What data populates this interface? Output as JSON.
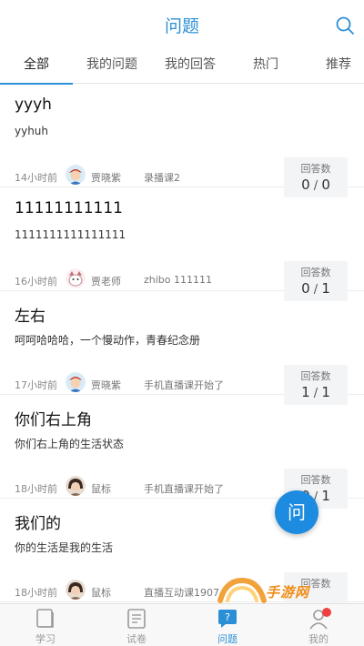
{
  "header": {
    "title": "问题"
  },
  "tabs": [
    {
      "label": "全部",
      "active": true
    },
    {
      "label": "我的问题",
      "active": false
    },
    {
      "label": "我的回答",
      "active": false
    },
    {
      "label": "热门",
      "active": false
    },
    {
      "label": "推荐",
      "active": false
    }
  ],
  "questions": [
    {
      "title": "yyyh",
      "desc": "yyhuh",
      "time": "14小时前",
      "author": "贾晓紫",
      "course": "录播课2",
      "answers_label": "回答数",
      "answered": "0",
      "total": "0",
      "avatar": "boy-avatar"
    },
    {
      "title": "11111111111",
      "desc": "1111111111111111",
      "time": "16小时前",
      "author": "贾老师",
      "course": "zhibo 111111",
      "answers_label": "回答数",
      "answered": "0",
      "total": "1",
      "avatar": "cartoon-avatar"
    },
    {
      "title": "左右",
      "desc": "呵呵哈哈哈，一个慢动作，青春纪念册",
      "time": "17小时前",
      "author": "贾晓紫",
      "course": "手机直播课开始了",
      "answers_label": "回答数",
      "answered": "1",
      "total": "1",
      "avatar": "boy-avatar"
    },
    {
      "title": "你们右上角",
      "desc": "你们右上角的生活状态",
      "time": "18小时前",
      "author": "鼠标",
      "course": "手机直播课开始了",
      "answers_label": "回答数",
      "answered": "0",
      "total": "1",
      "avatar": "girl-avatar"
    },
    {
      "title": "我们的",
      "desc": "你的生活是我的生活",
      "time": "18小时前",
      "author": "鼠标",
      "course": "直播互动课1907",
      "answers_label": "回答数",
      "answered": "",
      "total": "",
      "avatar": "girl-avatar"
    }
  ],
  "fab": {
    "label": "问"
  },
  "watermark": {
    "text": "手游网"
  },
  "bottom_nav": [
    {
      "label": "学习",
      "icon": "book-icon",
      "active": false
    },
    {
      "label": "试卷",
      "icon": "exam-icon",
      "active": false
    },
    {
      "label": "问题",
      "icon": "question-chat-icon",
      "active": true
    },
    {
      "label": "我的",
      "icon": "profile-icon",
      "active": false
    }
  ],
  "colors": {
    "accent": "#2b8fd6",
    "fab": "#1c8be0",
    "badge": "#f04040"
  }
}
